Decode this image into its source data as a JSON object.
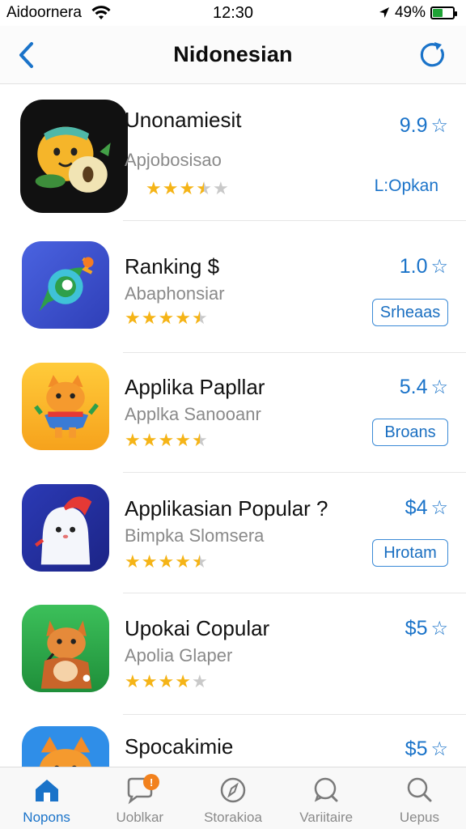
{
  "status_bar": {
    "carrier": "Aidoornera",
    "time": "12:30",
    "battery_percent": "49%",
    "battery_level": 0.49,
    "icons": [
      "wifi-icon",
      "location-arrow-icon",
      "battery-icon"
    ]
  },
  "nav": {
    "title": "Nidonesian",
    "back_icon": "chevron-left-icon",
    "refresh_icon": "refresh-icon"
  },
  "colors": {
    "accent": "#1a73c9",
    "star": "#f5b417",
    "star_empty": "#c9c9c9",
    "battery": "#1fa336",
    "badge": "#f2811d"
  },
  "apps": [
    {
      "name": "Unonamiesit",
      "subtitle": "Apjobosisao",
      "rating": 3.5,
      "price": "9.9",
      "action": "L:Opkan",
      "action_style": "link",
      "icon": "fruit-character-icon"
    },
    {
      "name": "Ranking $",
      "subtitle": "Abaphonsiar",
      "rating": 4.5,
      "price": "1.0",
      "action": "Srheaas",
      "action_style": "button",
      "icon": "swirl-leaf-icon"
    },
    {
      "name": "Applika Papllar",
      "subtitle": "Applka Sanooanr",
      "rating": 4.5,
      "price": "5.4",
      "action": "Broans",
      "action_style": "button",
      "icon": "cat-character-icon"
    },
    {
      "name": "Applikasian Popular ?",
      "subtitle": "Bimpka Slomsera",
      "rating": 4.5,
      "price": "$4",
      "action": "Hrotam",
      "action_style": "button",
      "icon": "ghost-character-icon"
    },
    {
      "name": "Upokai Copular",
      "subtitle": "Apolia Glaper",
      "rating": 4,
      "price": "$5",
      "action": "",
      "action_style": "none",
      "icon": "fox-character-icon"
    },
    {
      "name": "Spocakimie",
      "subtitle": "",
      "rating": 0,
      "price": "$5",
      "action": "",
      "action_style": "none",
      "icon": "cat-face-icon"
    }
  ],
  "tabs": [
    {
      "label": "Nopons",
      "icon": "home-icon",
      "active": true,
      "badge": ""
    },
    {
      "label": "Uoblkar",
      "icon": "chat-icon",
      "active": false,
      "badge": "!"
    },
    {
      "label": "Storakioa",
      "icon": "compass-icon",
      "active": false,
      "badge": ""
    },
    {
      "label": "Variitaire",
      "icon": "search-bubble-icon",
      "active": false,
      "badge": ""
    },
    {
      "label": "Uepus",
      "icon": "search-icon",
      "active": false,
      "badge": ""
    }
  ]
}
